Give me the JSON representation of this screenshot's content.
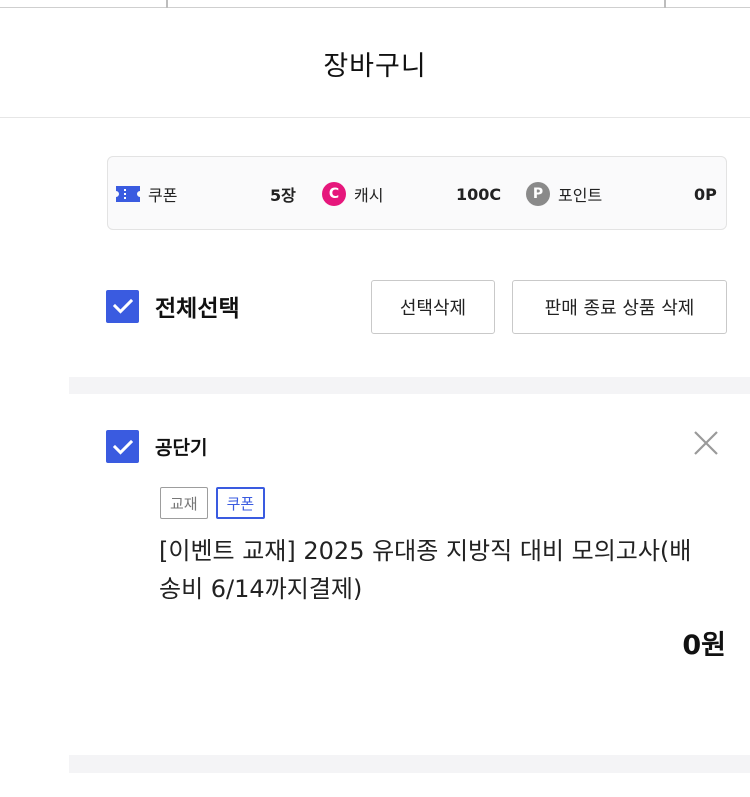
{
  "header": {
    "title": "장바구니"
  },
  "benefits": {
    "coupon": {
      "label": "쿠폰",
      "value": "5장",
      "icon": "ticket-icon"
    },
    "cash": {
      "label": "캐시",
      "value": "100C",
      "icon_letter": "C",
      "color": "#e6177c"
    },
    "point": {
      "label": "포인트",
      "value": "0P",
      "icon_letter": "P",
      "color": "#8a8a8a"
    }
  },
  "toolbar": {
    "select_all_label": "전체선택",
    "select_all_checked": true,
    "delete_selected_label": "선택삭제",
    "delete_ended_label": "판매 종료 상품 삭제"
  },
  "cart": {
    "seller": {
      "name": "공단기",
      "checked": true
    },
    "item": {
      "tags": [
        "교재",
        "쿠폰"
      ],
      "title_line1": "[이벤트 교재] 2025 유대종 지방직 대비 모의고사(배",
      "title_line2": "송비 6/14까지결제)",
      "price": "0원"
    }
  },
  "colors": {
    "accent": "#3a5be0",
    "cash": "#e6177c",
    "point": "#8a8a8a"
  }
}
